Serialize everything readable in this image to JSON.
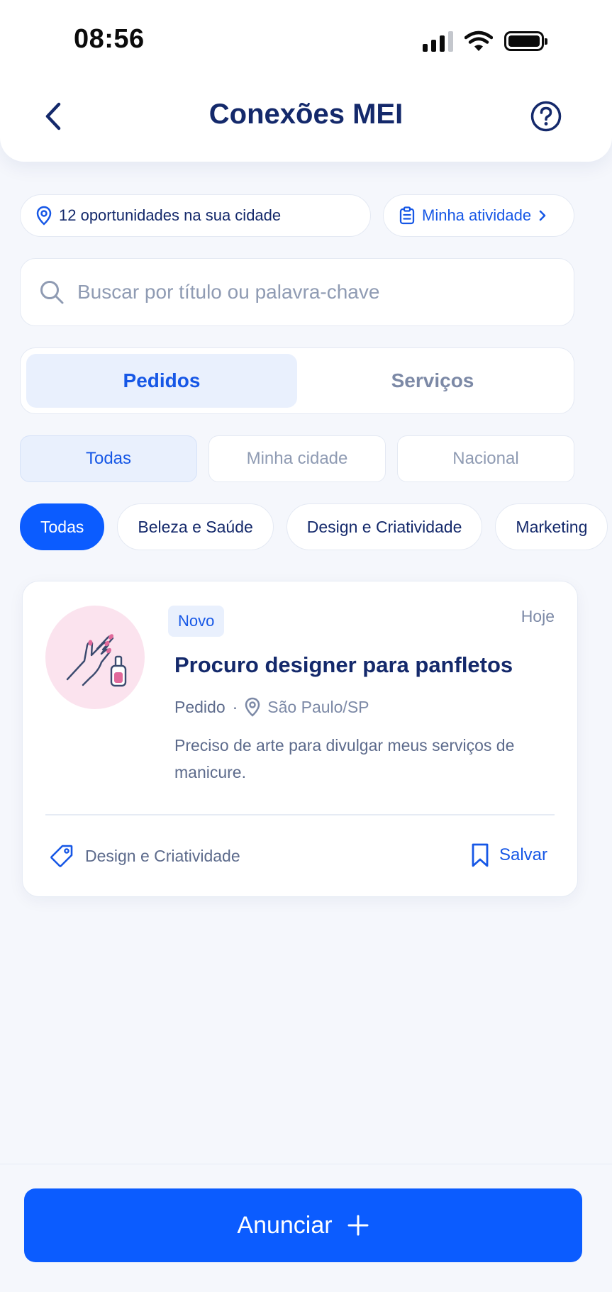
{
  "status_bar": {
    "time": "08:56"
  },
  "header": {
    "title": "Conexões MEI"
  },
  "location_pill": {
    "text": "12 oportunidades na sua cidade"
  },
  "activity_link": {
    "label": "Minha atividade"
  },
  "search": {
    "placeholder": "Buscar por título ou palavra-chave"
  },
  "tabs": [
    {
      "label": "Pedidos",
      "selected": true
    },
    {
      "label": "Serviços",
      "selected": false
    }
  ],
  "scope_filters": [
    {
      "label": "Todas",
      "selected": true
    },
    {
      "label": "Minha cidade",
      "selected": false
    },
    {
      "label": "Nacional",
      "selected": false
    }
  ],
  "category_chips": [
    {
      "label": "Todas",
      "selected": true
    },
    {
      "label": "Beleza e Saúde",
      "selected": false
    },
    {
      "label": "Design e Criatividade",
      "selected": false
    },
    {
      "label": "Marketing",
      "selected": false
    }
  ],
  "listing": {
    "badge": "Novo",
    "date": "Hoje",
    "title": "Procuro designer para panfletos",
    "type": "Pedido",
    "separator": "·",
    "city": "São Paulo/SP",
    "description": "Preciso de arte para divulgar meus serviços de manicure.",
    "category": "Design e Criatividade",
    "save_label": "Salvar",
    "thumbnail_icon": "manicure-hand-icon"
  },
  "cta": {
    "label": "Anunciar",
    "icon": "plus-icon"
  },
  "colors": {
    "primary": "#0b5cff",
    "text_primary": "#14296b",
    "accent_soft": "#e9f0fd",
    "background": "#f5f7fc"
  }
}
